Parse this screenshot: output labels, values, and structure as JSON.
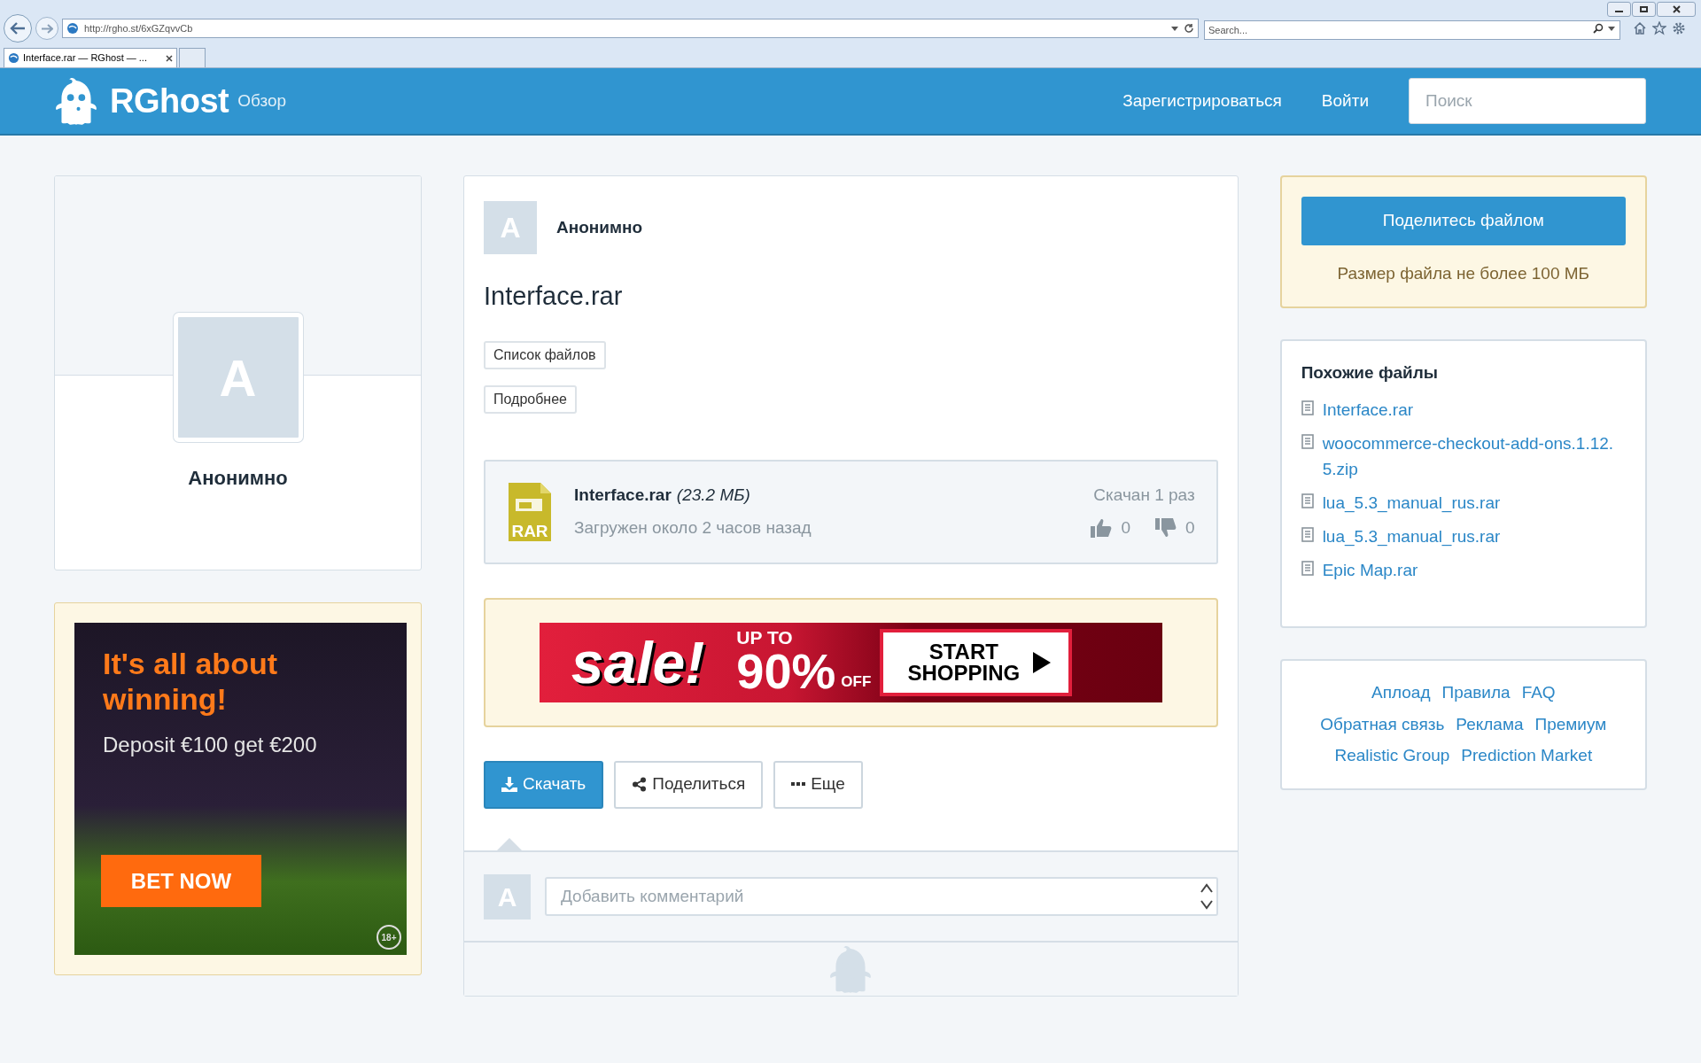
{
  "browser": {
    "url": "http://rgho.st/6xGZqvvCb",
    "search_placeholder": "Search...",
    "tabs": [
      {
        "title": "Interface.rar — RGhost — ...",
        "selected": true
      }
    ]
  },
  "header": {
    "logo": "RGhost",
    "nav": "Обзор",
    "links": [
      "Зарегистрироваться",
      "Войти"
    ],
    "search": {
      "placeholder": "Поиск"
    }
  },
  "profile": {
    "avatar_letter": "A",
    "name": "Анонимно"
  },
  "side_ad": {
    "headline": "It's all about winning!",
    "offer": "Deposit €100 get €200",
    "cta": "BET NOW",
    "badge": "18+"
  },
  "file": {
    "avatar_letter": "A",
    "author": "Анонимно",
    "title": "Interface.rar",
    "tags": [
      "Список файлов",
      "Подробнее"
    ],
    "card": {
      "name": "Interface.rar",
      "size": "(23.2 МБ)",
      "uploaded": "Загружен около 2 часов назад",
      "downloads": "Скачан 1 раз",
      "likes": "0",
      "dislikes": "0",
      "type_label": "RAR"
    },
    "banner": {
      "word": "sale!",
      "up_to": "UP TO",
      "percent": "90%",
      "off": "OFF",
      "cta": "START SHOPPING"
    },
    "actions": [
      {
        "label": "Скачать",
        "kind": "download"
      },
      {
        "label": "Поделиться",
        "kind": "share"
      },
      {
        "label": "Еще",
        "kind": "more"
      }
    ],
    "comment": {
      "avatar_letter": "A",
      "placeholder": "Добавить комментарий"
    }
  },
  "share": {
    "button": "Поделитесь файлом",
    "note": "Размер файла не более 100 МБ"
  },
  "similar": {
    "title": "Похожие файлы",
    "items": [
      "Interface.rar",
      "woocommerce-checkout-add-ons.1.12.5.zip",
      "lua_5.3_manual_rus.rar",
      "lua_5.3_manual_rus.rar",
      "Epic Map.rar"
    ]
  },
  "footer_links": [
    [
      "Аплоад",
      "Правила",
      "FAQ"
    ],
    [
      "Обратная связь",
      "Реклама",
      "Премиум"
    ],
    [
      "Realistic Group",
      "Prediction Market"
    ]
  ]
}
